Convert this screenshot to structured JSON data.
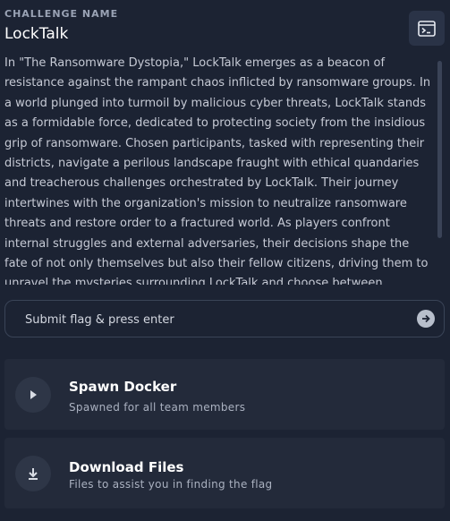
{
  "challenge": {
    "header_label": "CHALLENGE NAME",
    "name": "LockTalk",
    "description": "In \"The Ransomware Dystopia,\" LockTalk emerges as a beacon of resistance against the rampant chaos inflicted by ransomware groups. In a world plunged into turmoil by malicious cyber threats, LockTalk stands as a formidable force, dedicated to protecting society from the insidious grip of ransomware. Chosen participants, tasked with representing their districts, navigate a perilous landscape fraught with ethical quandaries and treacherous challenges orchestrated by LockTalk. Their journey intertwines with the organization's mission to neutralize ransomware threats and restore order to a fractured world. As players confront internal struggles and external adversaries, their decisions shape the fate of not only themselves but also their fellow citizens, driving them to unravel the mysteries surrounding LockTalk and choose between succumbing to despair or standing resilient"
  },
  "flag_input": {
    "placeholder": "Submit flag & press enter",
    "value": ""
  },
  "actions": {
    "spawn": {
      "title": "Spawn Docker",
      "subtitle": "Spawned for all team members",
      "icon": "play-icon"
    },
    "download": {
      "title": "Download Files",
      "subtitle": "Files to assist you in finding the flag",
      "icon": "download-icon"
    }
  },
  "colors": {
    "background": "#1c2333",
    "card": "#232a3a",
    "accent_gray": "#b8bfcc"
  }
}
